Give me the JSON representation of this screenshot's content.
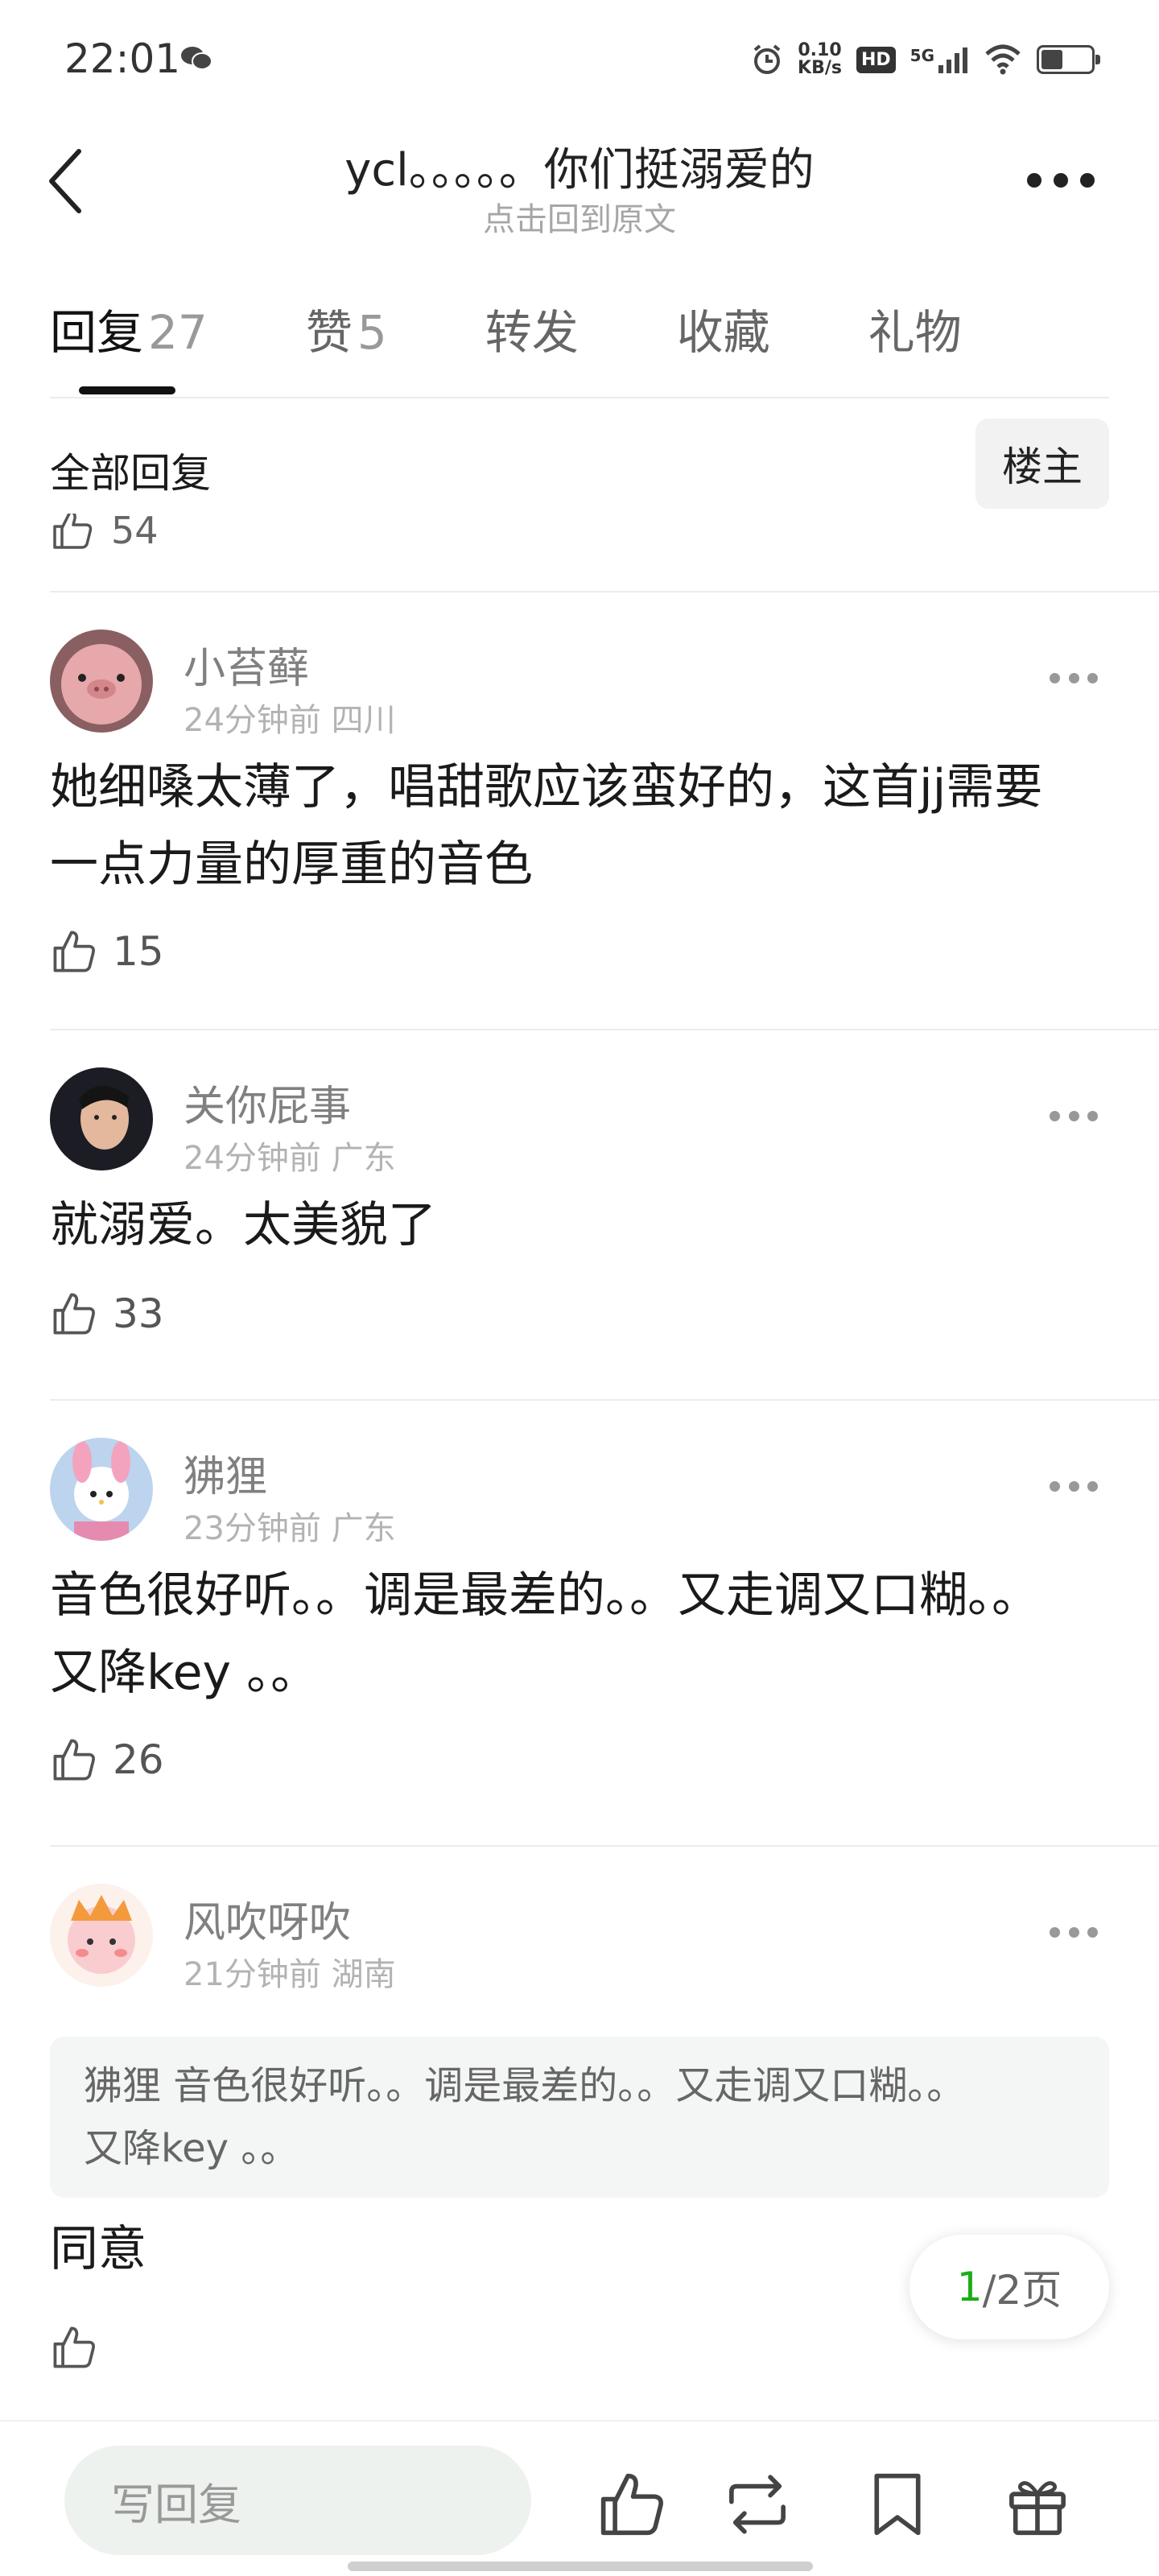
{
  "status_bar": {
    "time": "22:01",
    "net_speed_value": "0.10",
    "net_speed_unit": "KB/s",
    "hd_badge": "HD",
    "signal_label": "5G"
  },
  "header": {
    "title": "ycl。。。。。你们挺溺爱的",
    "subtitle": "点击回到原文"
  },
  "tabs": [
    {
      "label": "回复",
      "count": "27"
    },
    {
      "label": "赞",
      "count": "5"
    },
    {
      "label": "转发",
      "count": ""
    },
    {
      "label": "收藏",
      "count": ""
    },
    {
      "label": "礼物",
      "count": ""
    }
  ],
  "filter": {
    "label": "全部回复",
    "owner_button": "楼主"
  },
  "partial_like_count": "54",
  "comments": [
    {
      "username": "小苔藓",
      "time": "24分钟前",
      "location": "四川",
      "text_lines": [
        "她细嗓太薄了，唱甜歌应该蛮好的，这首jj需要",
        "一点力量的厚重的音色"
      ],
      "likes": "15"
    },
    {
      "username": "关你屁事",
      "time": "24分钟前",
      "location": "广东",
      "text_lines": [
        "就溺爱。太美貌了"
      ],
      "likes": "33"
    },
    {
      "username": "狒狸",
      "time": "23分钟前",
      "location": "广东",
      "text_lines": [
        "音色很好听。。调是最差的。。又走调又口糊。。",
        "又降key 。。"
      ],
      "likes": "26"
    },
    {
      "username": "风吹呀吹",
      "time": "21分钟前",
      "location": "湖南",
      "quote_lines": [
        "狒狸 音色很好听。。调是最差的。。又走调又口糊。。",
        "又降key 。。"
      ],
      "text_lines": [
        "同意"
      ],
      "likes": ""
    }
  ],
  "pager": {
    "current": "1",
    "total_text": "/2页"
  },
  "bottom_bar": {
    "reply_placeholder": "写回复"
  },
  "colors": {
    "accent_green": "#1aad19",
    "text_primary": "#1a1a1a",
    "text_secondary": "#808080",
    "meta_gray": "#b3b3b3"
  },
  "icons": [
    "back-icon",
    "more-icon",
    "thumbs-up-icon",
    "repost-icon",
    "bookmark-icon",
    "gift-icon",
    "wechat-icon",
    "alarm-icon",
    "wifi-icon",
    "battery-icon"
  ]
}
